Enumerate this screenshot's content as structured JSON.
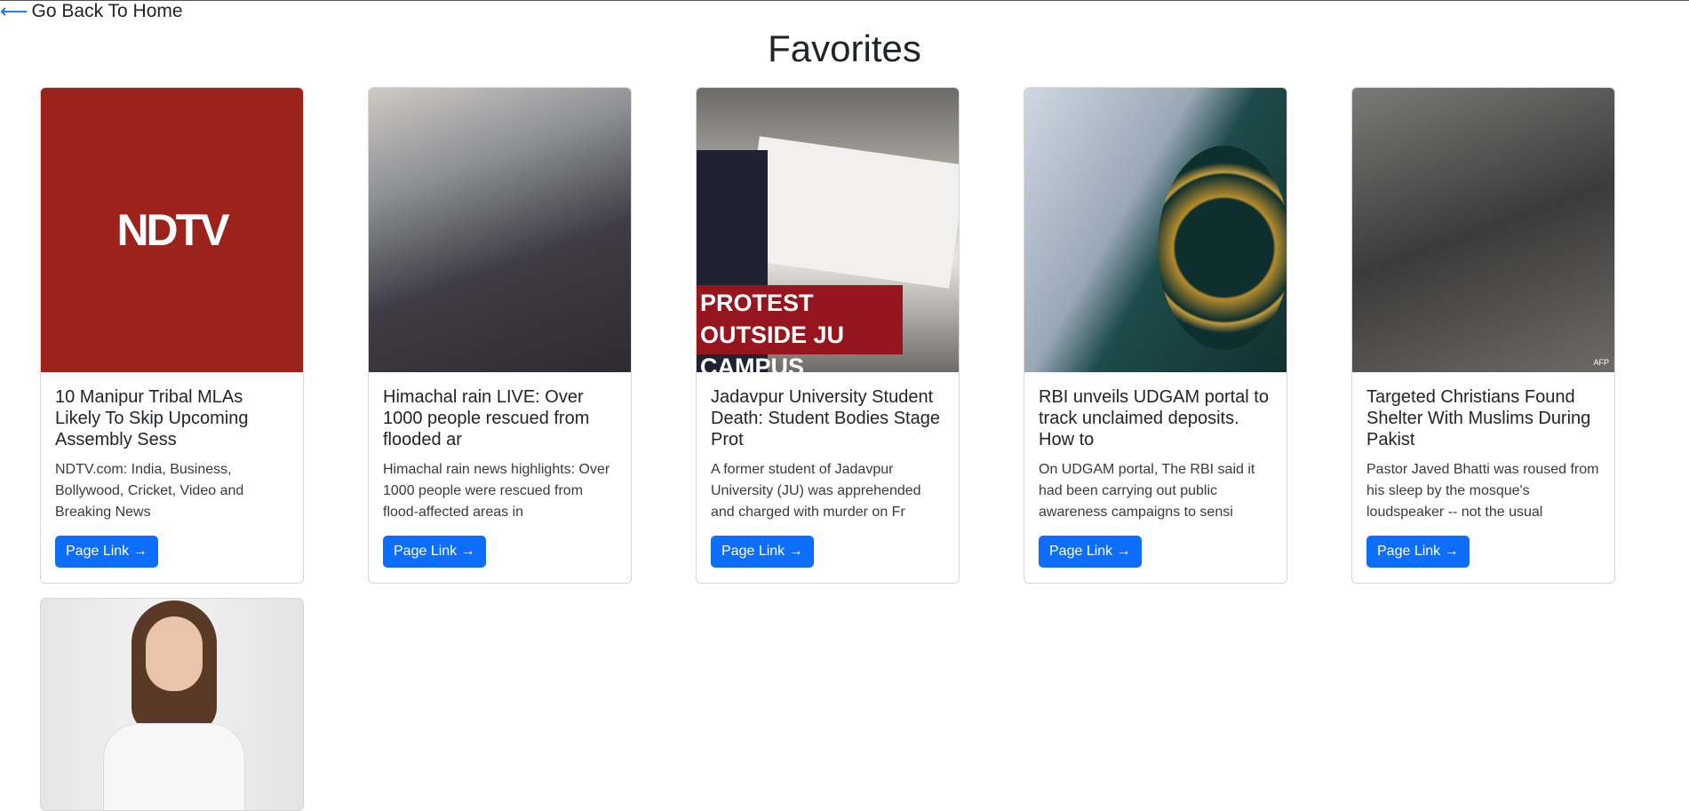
{
  "nav": {
    "back_arrow": "⟵",
    "back_label": "Go Back To Home"
  },
  "page": {
    "title": "Favorites"
  },
  "cards": [
    {
      "title": "10 Manipur Tribal MLAs Likely To Skip Upcoming Assembly Sess",
      "description": "NDTV.com: India, Business, Bollywood, Cricket, Video and Breaking News",
      "button": "Page Link →",
      "image_logo_text": "NDTV"
    },
    {
      "title": "Himachal rain LIVE: Over 1000 people rescued from flooded ar",
      "description": "Himachal rain news highlights: Over 1000 people were rescued from flood-affected areas in",
      "button": "Page Link →"
    },
    {
      "title": "Jadavpur University Student Death: Student Bodies Stage Prot",
      "description": "A former student of Jadavpur University (JU) was apprehended and charged with murder on Fr",
      "button": "Page Link →",
      "image_caption": "PROTEST OUTSIDE JU CAMPUS"
    },
    {
      "title": "RBI unveils UDGAM portal to track unclaimed deposits. How to",
      "description": "On UDGAM portal, The RBI said it had been carrying out public awareness campaigns to sensi",
      "button": "Page Link →"
    },
    {
      "title": "Targeted Christians Found Shelter With Muslims During Pakist",
      "description": "Pastor Javed Bhatti was roused from his sleep by the mosque's loudspeaker -- not the usual",
      "button": "Page Link →",
      "image_credit": "AFP"
    }
  ],
  "colors": {
    "primary": "#0d6efd",
    "ndtv_red": "#9b231c",
    "caption_red": "#96161f"
  }
}
